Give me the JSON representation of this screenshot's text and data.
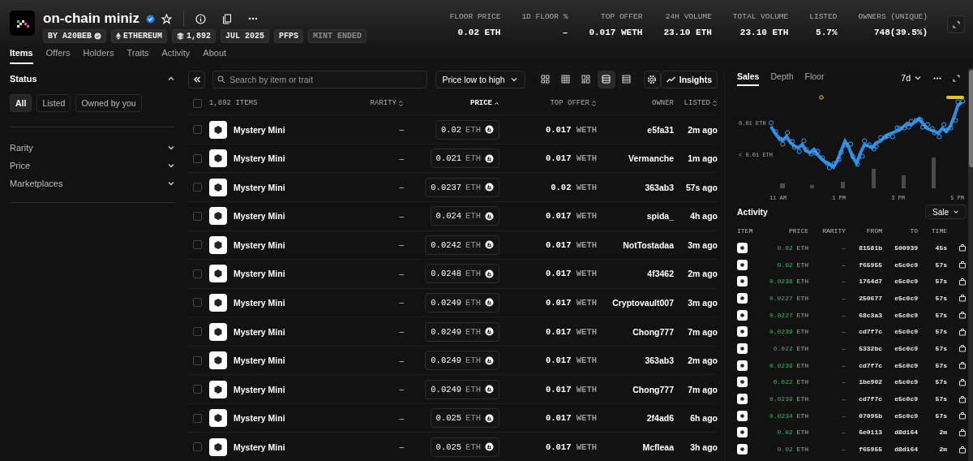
{
  "collection": {
    "name": "on-chain miniz",
    "verified": true,
    "starred": false,
    "tags": [
      {
        "label": "BY A20BEB",
        "kind": "creator"
      },
      {
        "label": "ETHEREUM",
        "kind": "chain"
      },
      {
        "label": "1,892",
        "kind": "supply"
      },
      {
        "label": "JUL 2025",
        "kind": "plain"
      },
      {
        "label": "PFPS",
        "kind": "plain"
      },
      {
        "label": "MINT ENDED",
        "kind": "status"
      }
    ]
  },
  "stats": [
    {
      "label": "FLOOR PRICE",
      "value": "0.02 ETH"
    },
    {
      "label": "1D FLOOR %",
      "value": "–"
    },
    {
      "label": "TOP OFFER",
      "value": "0.017 WETH"
    },
    {
      "label": "24H VOLUME",
      "value": "23.10 ETH"
    },
    {
      "label": "TOTAL VOLUME",
      "value": "23.10 ETH"
    },
    {
      "label": "LISTED",
      "value": "5.7%"
    },
    {
      "label": "OWNERS (UNIQUE)",
      "value": "748(39.5%)"
    }
  ],
  "tabs": [
    {
      "label": "Items",
      "selected": true
    },
    {
      "label": "Offers",
      "selected": false
    },
    {
      "label": "Holders",
      "selected": false
    },
    {
      "label": "Traits",
      "selected": false
    },
    {
      "label": "Activity",
      "selected": false
    },
    {
      "label": "About",
      "selected": false
    }
  ],
  "sidebar": {
    "status": {
      "title": "Status",
      "expanded": true,
      "options": [
        {
          "label": "All",
          "selected": true
        },
        {
          "label": "Listed",
          "selected": false
        },
        {
          "label": "Owned by you",
          "selected": false
        }
      ]
    },
    "filters": [
      {
        "label": "Rarity",
        "expanded": false
      },
      {
        "label": "Price",
        "expanded": false
      },
      {
        "label": "Marketplaces",
        "expanded": false
      }
    ]
  },
  "toolbar": {
    "search": {
      "placeholder": "Search by item or trait"
    },
    "sort": "Price low to high",
    "views": [
      {
        "kind": "grid-large",
        "selected": false
      },
      {
        "kind": "grid",
        "selected": false
      },
      {
        "kind": "grid-mixed",
        "selected": false
      },
      {
        "kind": "list",
        "selected": true
      },
      {
        "kind": "table",
        "selected": false
      }
    ],
    "insights": "Insights"
  },
  "table": {
    "select_all_checked": false,
    "columns": [
      {
        "label": "1,892 ITEMS",
        "sortable": false,
        "sorted": false
      },
      {
        "label": "RARITY",
        "sortable": true,
        "sorted": false
      },
      {
        "label": "PRICE",
        "sortable": true,
        "sorted": true
      },
      {
        "label": "TOP OFFER",
        "sortable": true,
        "sorted": false
      },
      {
        "label": "OWNER",
        "sortable": false,
        "sorted": false
      },
      {
        "label": "LISTED",
        "sortable": true,
        "sorted": false
      }
    ],
    "rows": [
      {
        "name": "Mystery Mini",
        "rarity": "–",
        "price": "0.02",
        "unit": "ETH",
        "top_offer": "0.017",
        "offer_unit": "WETH",
        "owner": "e5fa31",
        "listed": "2m ago",
        "checked": false
      },
      {
        "name": "Mystery Mini",
        "rarity": "–",
        "price": "0.021",
        "unit": "ETH",
        "top_offer": "0.017",
        "offer_unit": "WETH",
        "owner": "Vermanche",
        "listed": "1m ago",
        "checked": false
      },
      {
        "name": "Mystery Mini",
        "rarity": "–",
        "price": "0.0237",
        "unit": "ETH",
        "top_offer": "0.02",
        "offer_unit": "WETH",
        "owner": "363ab3",
        "listed": "57s ago",
        "checked": false
      },
      {
        "name": "Mystery Mini",
        "rarity": "–",
        "price": "0.024",
        "unit": "ETH",
        "top_offer": "0.017",
        "offer_unit": "WETH",
        "owner": "spida_",
        "listed": "4h ago",
        "checked": false
      },
      {
        "name": "Mystery Mini",
        "rarity": "–",
        "price": "0.0242",
        "unit": "ETH",
        "top_offer": "0.017",
        "offer_unit": "WETH",
        "owner": "NotTostadaa",
        "listed": "3m ago",
        "checked": false
      },
      {
        "name": "Mystery Mini",
        "rarity": "–",
        "price": "0.0248",
        "unit": "ETH",
        "top_offer": "0.017",
        "offer_unit": "WETH",
        "owner": "4f3462",
        "listed": "2m ago",
        "checked": false
      },
      {
        "name": "Mystery Mini",
        "rarity": "–",
        "price": "0.0249",
        "unit": "ETH",
        "top_offer": "0.017",
        "offer_unit": "WETH",
        "owner": "Cryptovault007",
        "listed": "3m ago",
        "checked": false
      },
      {
        "name": "Mystery Mini",
        "rarity": "–",
        "price": "0.0249",
        "unit": "ETH",
        "top_offer": "0.017",
        "offer_unit": "WETH",
        "owner": "Chong777",
        "listed": "7m ago",
        "checked": false
      },
      {
        "name": "Mystery Mini",
        "rarity": "–",
        "price": "0.0249",
        "unit": "ETH",
        "top_offer": "0.017",
        "offer_unit": "WETH",
        "owner": "363ab3",
        "listed": "2m ago",
        "checked": false
      },
      {
        "name": "Mystery Mini",
        "rarity": "–",
        "price": "0.0249",
        "unit": "ETH",
        "top_offer": "0.017",
        "offer_unit": "WETH",
        "owner": "Chong777",
        "listed": "7m ago",
        "checked": false
      },
      {
        "name": "Mystery Mini",
        "rarity": "–",
        "price": "0.025",
        "unit": "ETH",
        "top_offer": "0.017",
        "offer_unit": "WETH",
        "owner": "2f4ad6",
        "listed": "6h ago",
        "checked": false
      },
      {
        "name": "Mystery Mini",
        "rarity": "–",
        "price": "0.025",
        "unit": "ETH",
        "top_offer": "0.017",
        "offer_unit": "WETH",
        "owner": "Mcfleaa",
        "listed": "3h ago",
        "checked": false
      }
    ]
  },
  "insights": {
    "tabs": [
      {
        "label": "Sales",
        "selected": true
      },
      {
        "label": "Depth",
        "selected": false
      },
      {
        "label": "Floor",
        "selected": false
      }
    ],
    "range": "7d",
    "y_labels": [
      "0.01 ETH",
      "< 0.01 ETH"
    ],
    "x_labels": [
      "11 AM",
      "1 PM",
      "3 PM",
      "5 PM"
    ],
    "activity": {
      "title": "Activity",
      "filter": "Sale",
      "columns": [
        "ITEM",
        "PRICE",
        "RARITY",
        "FROM",
        "TO",
        "TIME"
      ],
      "rows": [
        {
          "price": "0.02",
          "unit": "ETH",
          "rarity": "–",
          "from": "81581b",
          "to": "500939",
          "time": "45s"
        },
        {
          "price": "0.02",
          "unit": "ETH",
          "rarity": "–",
          "from": "f65955",
          "to": "e5c0c9",
          "time": "57s"
        },
        {
          "price": "0.0238",
          "unit": "ETH",
          "rarity": "–",
          "from": "1764d7",
          "to": "e5c0c9",
          "time": "57s"
        },
        {
          "price": "0.0227",
          "unit": "ETH",
          "rarity": "–",
          "from": "250677",
          "to": "e5c0c9",
          "time": "57s"
        },
        {
          "price": "0.0227",
          "unit": "ETH",
          "rarity": "–",
          "from": "68c3a3",
          "to": "e5c0c9",
          "time": "57s"
        },
        {
          "price": "0.0239",
          "unit": "ETH",
          "rarity": "–",
          "from": "cd7f7c",
          "to": "e5c0c9",
          "time": "57s"
        },
        {
          "price": "0.022",
          "unit": "ETH",
          "rarity": "–",
          "from": "5332bc",
          "to": "e5c0c9",
          "time": "57s"
        },
        {
          "price": "0.0239",
          "unit": "ETH",
          "rarity": "–",
          "from": "cd7f7c",
          "to": "e5c0c9",
          "time": "57s"
        },
        {
          "price": "0.022",
          "unit": "ETH",
          "rarity": "–",
          "from": "1be902",
          "to": "e5c0c9",
          "time": "57s"
        },
        {
          "price": "0.0239",
          "unit": "ETH",
          "rarity": "–",
          "from": "cd7f7c",
          "to": "e5c0c9",
          "time": "57s"
        },
        {
          "price": "0.0234",
          "unit": "ETH",
          "rarity": "–",
          "from": "07095b",
          "to": "e5c0c9",
          "time": "57s"
        },
        {
          "price": "0.02",
          "unit": "ETH",
          "rarity": "–",
          "from": "6e0113",
          "to": "d8d164",
          "time": "2m"
        },
        {
          "price": "0.02",
          "unit": "ETH",
          "rarity": "–",
          "from": "f65955",
          "to": "d8d164",
          "time": "2m"
        }
      ]
    }
  }
}
